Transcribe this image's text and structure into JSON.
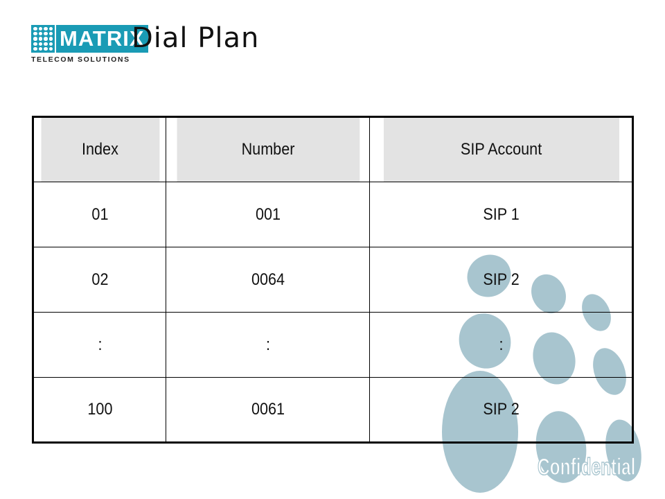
{
  "logo": {
    "wordmark": "MATRIX",
    "tagline": "TELECOM SOLUTIONS"
  },
  "slide": {
    "title": "Dial Plan"
  },
  "table": {
    "headers": [
      "Index",
      "Number",
      "SIP Account"
    ],
    "rows": [
      [
        "01",
        "001",
        "SIP 1"
      ],
      [
        "02",
        "0064",
        "SIP 2"
      ],
      [
        ":",
        ":",
        ":"
      ],
      [
        "100",
        "0061",
        "SIP 2"
      ]
    ]
  },
  "watermark": {
    "text": "Confidential"
  },
  "colors": {
    "brand": "#1a9bb5",
    "header_fill": "#e3e3e3",
    "decoration": "#a8c5cf"
  }
}
